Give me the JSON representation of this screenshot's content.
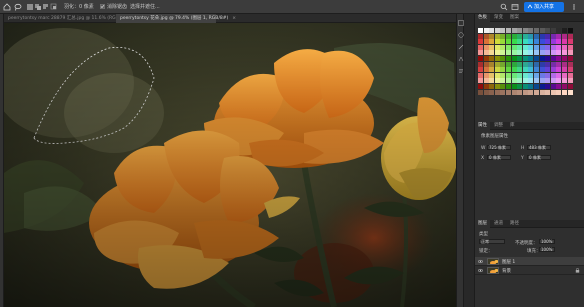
{
  "options_bar": {
    "feather_label": "羽化：",
    "feather_value": "0 像素",
    "antialias_label": "消除锯齿",
    "refine_label": "选择并遮住...",
    "share_label": "加入共享",
    "icons": [
      "home-icon",
      "lasso-tool-icon",
      "new-selection-icon",
      "add-selection-icon",
      "subtract-selection-icon",
      "intersect-selection-icon",
      "search-icon",
      "workspace-icon",
      "share-icon"
    ]
  },
  "document_tabs": [
    {
      "label": "peerrytontsy marc 28879 汇总.jpg @ 11.6% (RGB/8#)",
      "close": "×",
      "active": false
    },
    {
      "label": "peerrytontsy 花朵.jpg @ 79.4% (图层 1, RGB/8#)",
      "close": "×",
      "active": true
    }
  ],
  "swatches_panel": {
    "tabs": [
      "色板",
      "渐变",
      "图案"
    ],
    "active_tab": 0
  },
  "properties_panel": {
    "tabs": [
      "属性",
      "调整",
      "库"
    ],
    "active_tab": 0,
    "header": "像素图层属性",
    "field_w_label": "W",
    "field_w_value": "725 像素",
    "field_h_label": "H",
    "field_h_value": "483 像素",
    "field_x_label": "X",
    "field_x_value": "0 像素",
    "field_y_label": "Y",
    "field_y_value": "0 像素"
  },
  "layers_panel": {
    "tabs": [
      "图层",
      "通道",
      "路径"
    ],
    "active_tab": 0,
    "filter_label": "类型",
    "blend_mode": "正常",
    "opacity_label": "不透明度：",
    "opacity_value": "100%",
    "lock_label": "锁定：",
    "fill_label": "填充：",
    "fill_value": "100%",
    "layers": [
      {
        "name": "图层 1",
        "selected": true
      },
      {
        "name": "背景",
        "selected": false
      }
    ]
  },
  "colors": {
    "accent": "#1473e6",
    "panel_bg": "#2f2f2f",
    "app_bg": "#282828"
  }
}
